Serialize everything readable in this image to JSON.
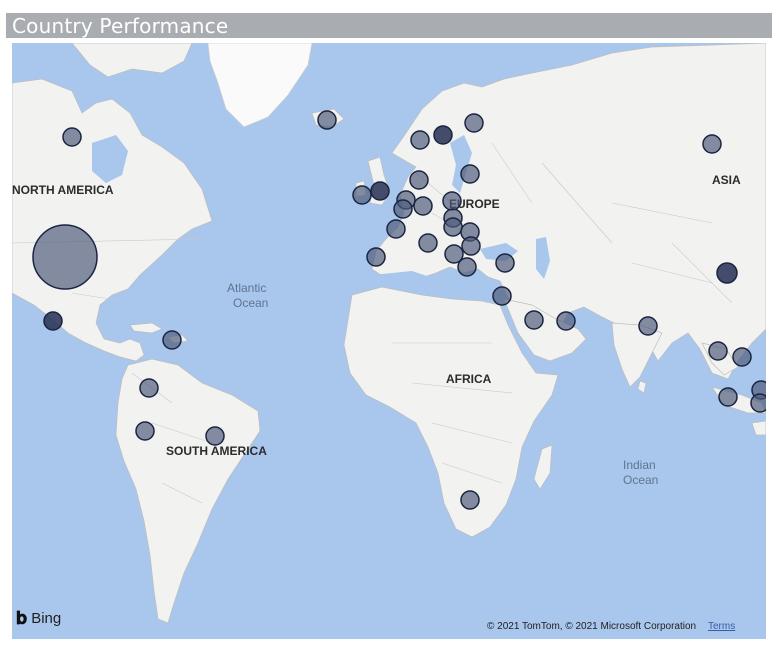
{
  "title": "Country Performance",
  "map": {
    "labels": {
      "north_america": "NORTH AMERICA",
      "south_america": "SOUTH AMERICA",
      "europe": "EUROPE",
      "africa": "AFRICA",
      "asia": "ASIA",
      "atlantic_1": "Atlantic",
      "atlantic_2": "Ocean",
      "indian_1": "Indian",
      "indian_2": "Ocean"
    },
    "bubble_color": "#4d5a7a",
    "bubble_dark_color": "#2a3458",
    "land_color": "#f2f2f0",
    "water_color": "#a9c6ec"
  },
  "footer": {
    "brand": "Bing",
    "copyright": "© 2021 TomTom, © 2021 Microsoft Corporation",
    "terms": "Terms"
  }
}
